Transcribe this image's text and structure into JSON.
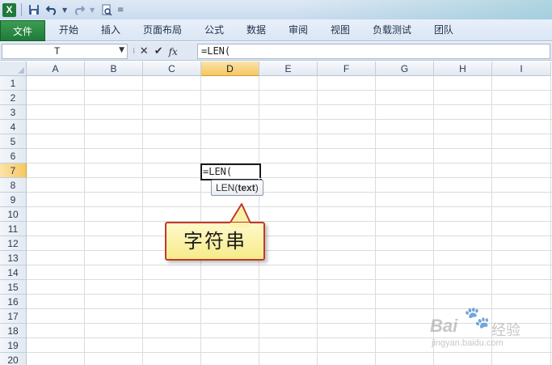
{
  "app": {
    "accent_file_tab": "#1f7a3a",
    "selected_header_color": "#f5c862"
  },
  "quick_access": {
    "icons": [
      "excel-logo-icon",
      "save-icon",
      "undo-icon",
      "redo-icon",
      "print-preview-icon",
      "customize-icon"
    ]
  },
  "ribbon": {
    "file_tab": "文件",
    "tabs": [
      "开始",
      "插入",
      "页面布局",
      "公式",
      "数据",
      "审阅",
      "视图",
      "负载测试",
      "团队"
    ]
  },
  "formula_bar": {
    "name_box": "T",
    "formula": "=LEN("
  },
  "grid": {
    "columns": [
      "A",
      "B",
      "C",
      "D",
      "E",
      "F",
      "G",
      "H",
      "I"
    ],
    "rows": [
      "1",
      "2",
      "3",
      "4",
      "5",
      "6",
      "7",
      "8",
      "9",
      "10",
      "11",
      "12",
      "13",
      "14",
      "15",
      "16",
      "17",
      "18",
      "19",
      "20"
    ],
    "active_column": "D",
    "active_row": "7",
    "active_cell_content": "=LEN("
  },
  "tooltip": {
    "func": "LEN(",
    "arg": "text",
    "close": ")"
  },
  "callout": {
    "text": "字符串",
    "border_color": "#c0392b",
    "fill_color": "#f6eb8a"
  },
  "watermark": {
    "brand": "Bai",
    "brand_cn": "经验",
    "url": "jingyan.baidu.com"
  }
}
